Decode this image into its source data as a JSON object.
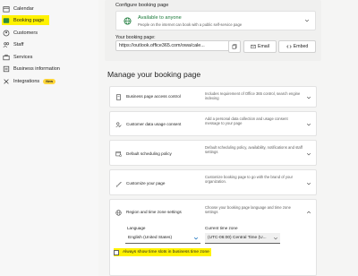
{
  "sidebar": {
    "items": [
      {
        "label": "Calendar",
        "icon": "calendar-icon"
      },
      {
        "label": "Booking page",
        "icon": "booking-page-icon",
        "active": true
      },
      {
        "label": "Customers",
        "icon": "customers-icon"
      },
      {
        "label": "Staff",
        "icon": "staff-icon"
      },
      {
        "label": "Services",
        "icon": "services-icon"
      },
      {
        "label": "Business information",
        "icon": "business-info-icon"
      },
      {
        "label": "Integrations",
        "icon": "integrations-icon",
        "badge": "New"
      }
    ]
  },
  "configure": {
    "title": "Configure booking page",
    "availability_title": "Available to anyone",
    "availability_subtitle": "People on the internet can book with a public self-service page",
    "your_page_label": "Your booking page:",
    "url": "https://outlook.office365.com/owa/cale...",
    "email_label": "Email",
    "embed_label": "Embed"
  },
  "manage": {
    "title": "Manage your booking page",
    "panels": [
      {
        "title": "Business page access control",
        "desc": "Includes requirement of Office 365 control, search engine indexing"
      },
      {
        "title": "Customer data usage consent",
        "desc": "Add a personal data collection and usage consent message to your page"
      },
      {
        "title": "Default scheduling policy",
        "desc": "Default scheduling policy, availability, notifications and staff settings"
      },
      {
        "title": "Customize your page",
        "desc": "Customize booking page to go with the brand of your organization."
      },
      {
        "title": "Region and time zone settings",
        "desc": "Choose your booking page language and time zone settings"
      }
    ]
  },
  "region": {
    "language_label": "Language",
    "language_value": "English (United States)",
    "timezone_label": "Current time zone",
    "timezone_value": "(UTC-06:00) Central Time (U...",
    "checkbox_label": "Always show time slots in business time zone",
    "checked": false
  },
  "colors": {
    "highlight": "#fff200",
    "available_green": "#1a7a39",
    "badge_yellow": "#ffd63a"
  }
}
